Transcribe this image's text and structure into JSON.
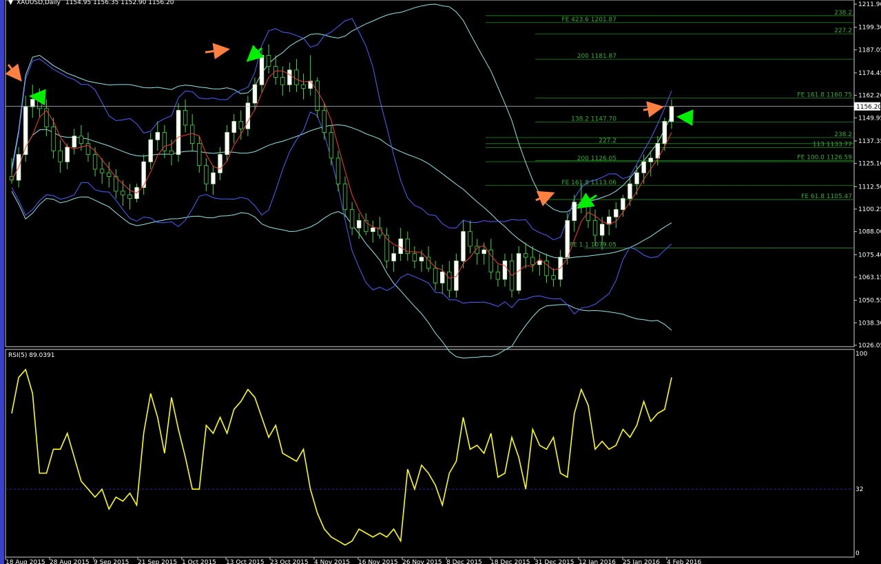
{
  "header": {
    "symbol": "XAUUSD,Daily",
    "ohlc": "1154.95 1156.35 1152.90 1156.20"
  },
  "colors": {
    "up_candle": "#ffffff",
    "up_candle_hi": "#c8ffb4",
    "wick": "#3cdc3c",
    "bb_outer": "#8fe6e6",
    "bb_inner": "#4d62ff",
    "ema": "#ff3a30",
    "fib": "#1f8f1f",
    "rsi": "#ffff00",
    "arrow_orange": "#ff8040",
    "arrow_green": "#00ee00",
    "price_line": "#c0c0c0"
  },
  "chart_data": [
    {
      "type": "candlestick",
      "y_axis": {
        "ticks": [
          "1211.90",
          "1199.30",
          "1187.05",
          "1174.45",
          "1162.20",
          "1149.95",
          "1137.35",
          "1125.10",
          "1112.50",
          "1100.25",
          "1088.00",
          "1075.40",
          "1063.15",
          "1050.55",
          "1038.30",
          "1026.05"
        ],
        "range": [
          1026.05,
          1211.9
        ]
      },
      "current_price": "1156.20",
      "x_axis": {
        "tick_labels": [
          "18 Aug 2015",
          "28 Aug 2015",
          "9 Sep 2015",
          "21 Sep 2015",
          "1 Oct 2015",
          "13 Oct 2015",
          "23 Oct 2015",
          "4 Nov 2015",
          "16 Nov 2015",
          "26 Nov 2015",
          "8 Dec 2015",
          "18 Dec 2015",
          "31 Dec 2015",
          "12 Jan 2016",
          "25 Jan 2016",
          "4 Feb 2016"
        ]
      },
      "fib_levels": [
        {
          "label": "238.2",
          "price": 1205.6,
          "x_from": 0.0
        },
        {
          "label": "FE 423.6 1201.87",
          "price": 1201.87,
          "x_from": 0.0
        },
        {
          "label": "227.2",
          "price": 1195.7,
          "x_from": 0.1
        },
        {
          "label": "200 1181.87",
          "price": 1181.87,
          "x_from": 0.1
        },
        {
          "label": "FE 161.8 1160.75",
          "price": 1160.75,
          "x_from": 0.1
        },
        {
          "label": "138.2 1147.70",
          "price": 1147.7,
          "x_from": 0.1
        },
        {
          "label": "238.2",
          "price": 1139.2,
          "x_from": 0.0
        },
        {
          "label": "227.2",
          "price": 1135.9,
          "x_from": 0.0
        },
        {
          "label": "113 1133.77",
          "price": 1133.77,
          "x_from": 0.0
        },
        {
          "label": "200 1126.05",
          "price": 1126.05,
          "x_from": 0.0
        },
        {
          "label": "FE 100.0 1126.59",
          "price": 1126.59,
          "x_from": 0.1
        },
        {
          "label": "FE 161.8 1113.06",
          "price": 1113.06,
          "x_from": 0.0
        },
        {
          "label": "FE 61.8 1105.47",
          "price": 1105.47,
          "x_from": 0.1
        },
        {
          "label": "FE 1.1 1079.05",
          "price": 1079.05,
          "x_from": 0.2
        }
      ],
      "candles": [
        [
          1118,
          1128,
          1114,
          1116
        ],
        [
          1116,
          1134,
          1112,
          1130
        ],
        [
          1130,
          1162,
          1126,
          1156
        ],
        [
          1156,
          1168,
          1150,
          1160
        ],
        [
          1160,
          1166,
          1150,
          1155
        ],
        [
          1155,
          1160,
          1140,
          1145
        ],
        [
          1145,
          1150,
          1128,
          1132
        ],
        [
          1132,
          1138,
          1120,
          1126
        ],
        [
          1126,
          1136,
          1122,
          1134
        ],
        [
          1134,
          1144,
          1130,
          1140
        ],
        [
          1140,
          1146,
          1132,
          1136
        ],
        [
          1136,
          1142,
          1126,
          1130
        ],
        [
          1130,
          1134,
          1118,
          1122
        ],
        [
          1122,
          1128,
          1114,
          1120
        ],
        [
          1120,
          1126,
          1112,
          1118
        ],
        [
          1118,
          1122,
          1106,
          1110
        ],
        [
          1110,
          1116,
          1102,
          1108
        ],
        [
          1108,
          1114,
          1100,
          1106
        ],
        [
          1106,
          1114,
          1104,
          1112
        ],
        [
          1112,
          1130,
          1108,
          1126
        ],
        [
          1126,
          1142,
          1122,
          1138
        ],
        [
          1138,
          1148,
          1132,
          1142
        ],
        [
          1142,
          1146,
          1128,
          1132
        ],
        [
          1132,
          1138,
          1124,
          1130
        ],
        [
          1130,
          1158,
          1126,
          1154
        ],
        [
          1154,
          1160,
          1142,
          1146
        ],
        [
          1146,
          1152,
          1132,
          1136
        ],
        [
          1136,
          1140,
          1120,
          1124
        ],
        [
          1124,
          1128,
          1110,
          1114
        ],
        [
          1114,
          1124,
          1108,
          1120
        ],
        [
          1120,
          1134,
          1116,
          1130
        ],
        [
          1130,
          1146,
          1126,
          1142
        ],
        [
          1142,
          1152,
          1136,
          1148
        ],
        [
          1148,
          1154,
          1138,
          1144
        ],
        [
          1144,
          1162,
          1140,
          1158
        ],
        [
          1158,
          1172,
          1154,
          1168
        ],
        [
          1168,
          1188,
          1164,
          1184
        ],
        [
          1184,
          1190,
          1174,
          1178
        ],
        [
          1178,
          1184,
          1168,
          1172
        ],
        [
          1172,
          1178,
          1162,
          1168
        ],
        [
          1168,
          1180,
          1164,
          1176
        ],
        [
          1176,
          1182,
          1164,
          1168
        ],
        [
          1168,
          1174,
          1160,
          1166
        ],
        [
          1166,
          1184,
          1162,
          1170
        ],
        [
          1170,
          1172,
          1150,
          1154
        ],
        [
          1154,
          1158,
          1138,
          1142
        ],
        [
          1142,
          1146,
          1124,
          1128
        ],
        [
          1128,
          1132,
          1110,
          1114
        ],
        [
          1114,
          1118,
          1096,
          1100
        ],
        [
          1100,
          1104,
          1086,
          1090
        ],
        [
          1090,
          1098,
          1084,
          1094
        ],
        [
          1094,
          1098,
          1086,
          1088
        ],
        [
          1088,
          1094,
          1082,
          1090
        ],
        [
          1090,
          1096,
          1084,
          1086
        ],
        [
          1086,
          1090,
          1068,
          1072
        ],
        [
          1072,
          1080,
          1066,
          1076
        ],
        [
          1076,
          1090,
          1072,
          1084
        ],
        [
          1084,
          1088,
          1072,
          1076
        ],
        [
          1076,
          1080,
          1068,
          1072
        ],
        [
          1072,
          1078,
          1066,
          1074
        ],
        [
          1074,
          1080,
          1066,
          1068
        ],
        [
          1068,
          1072,
          1056,
          1060
        ],
        [
          1060,
          1070,
          1054,
          1066
        ],
        [
          1066,
          1072,
          1052,
          1056
        ],
        [
          1056,
          1076,
          1052,
          1072
        ],
        [
          1072,
          1094,
          1068,
          1088
        ],
        [
          1088,
          1094,
          1076,
          1080
        ],
        [
          1080,
          1084,
          1070,
          1076
        ],
        [
          1076,
          1082,
          1070,
          1078
        ],
        [
          1078,
          1084,
          1062,
          1066
        ],
        [
          1066,
          1070,
          1058,
          1062
        ],
        [
          1062,
          1076,
          1058,
          1072
        ],
        [
          1072,
          1076,
          1052,
          1056
        ],
        [
          1056,
          1080,
          1054,
          1076
        ],
        [
          1076,
          1082,
          1068,
          1074
        ],
        [
          1074,
          1080,
          1066,
          1070
        ],
        [
          1070,
          1076,
          1064,
          1072
        ],
        [
          1072,
          1076,
          1060,
          1064
        ],
        [
          1064,
          1068,
          1058,
          1062
        ],
        [
          1062,
          1078,
          1058,
          1074
        ],
        [
          1074,
          1098,
          1070,
          1094
        ],
        [
          1094,
          1108,
          1088,
          1104
        ],
        [
          1104,
          1114,
          1098,
          1102
        ],
        [
          1102,
          1106,
          1090,
          1094
        ],
        [
          1094,
          1100,
          1080,
          1086
        ],
        [
          1086,
          1096,
          1078,
          1092
        ],
        [
          1092,
          1100,
          1086,
          1096
        ],
        [
          1096,
          1104,
          1090,
          1100
        ],
        [
          1100,
          1108,
          1096,
          1106
        ],
        [
          1106,
          1118,
          1102,
          1114
        ],
        [
          1114,
          1124,
          1108,
          1120
        ],
        [
          1120,
          1130,
          1114,
          1126
        ],
        [
          1126,
          1132,
          1118,
          1128
        ],
        [
          1128,
          1140,
          1124,
          1136
        ],
        [
          1136,
          1150,
          1132,
          1148
        ],
        [
          1148,
          1160,
          1144,
          1156
        ]
      ]
    },
    {
      "type": "line",
      "title": "RSI(5) 89.0391",
      "y_axis": {
        "ticks": [
          "100",
          "32",
          "0"
        ],
        "range": [
          0,
          100
        ]
      },
      "level": 32,
      "values": [
        70,
        88,
        92,
        80,
        40,
        40,
        52,
        52,
        60,
        48,
        36,
        32,
        28,
        32,
        22,
        28,
        26,
        30,
        24,
        60,
        80,
        68,
        50,
        78,
        62,
        48,
        32,
        32,
        64,
        60,
        68,
        60,
        72,
        76,
        82,
        78,
        68,
        58,
        64,
        50,
        48,
        46,
        52,
        32,
        20,
        12,
        8,
        6,
        4,
        6,
        12,
        10,
        8,
        10,
        8,
        12,
        6,
        42,
        32,
        44,
        40,
        34,
        24,
        40,
        46,
        68,
        52,
        54,
        50,
        60,
        38,
        40,
        58,
        48,
        32,
        62,
        54,
        52,
        58,
        40,
        38,
        70,
        82,
        74,
        52,
        56,
        52,
        54,
        62,
        58,
        64,
        76,
        66,
        70,
        72,
        88
      ]
    }
  ]
}
